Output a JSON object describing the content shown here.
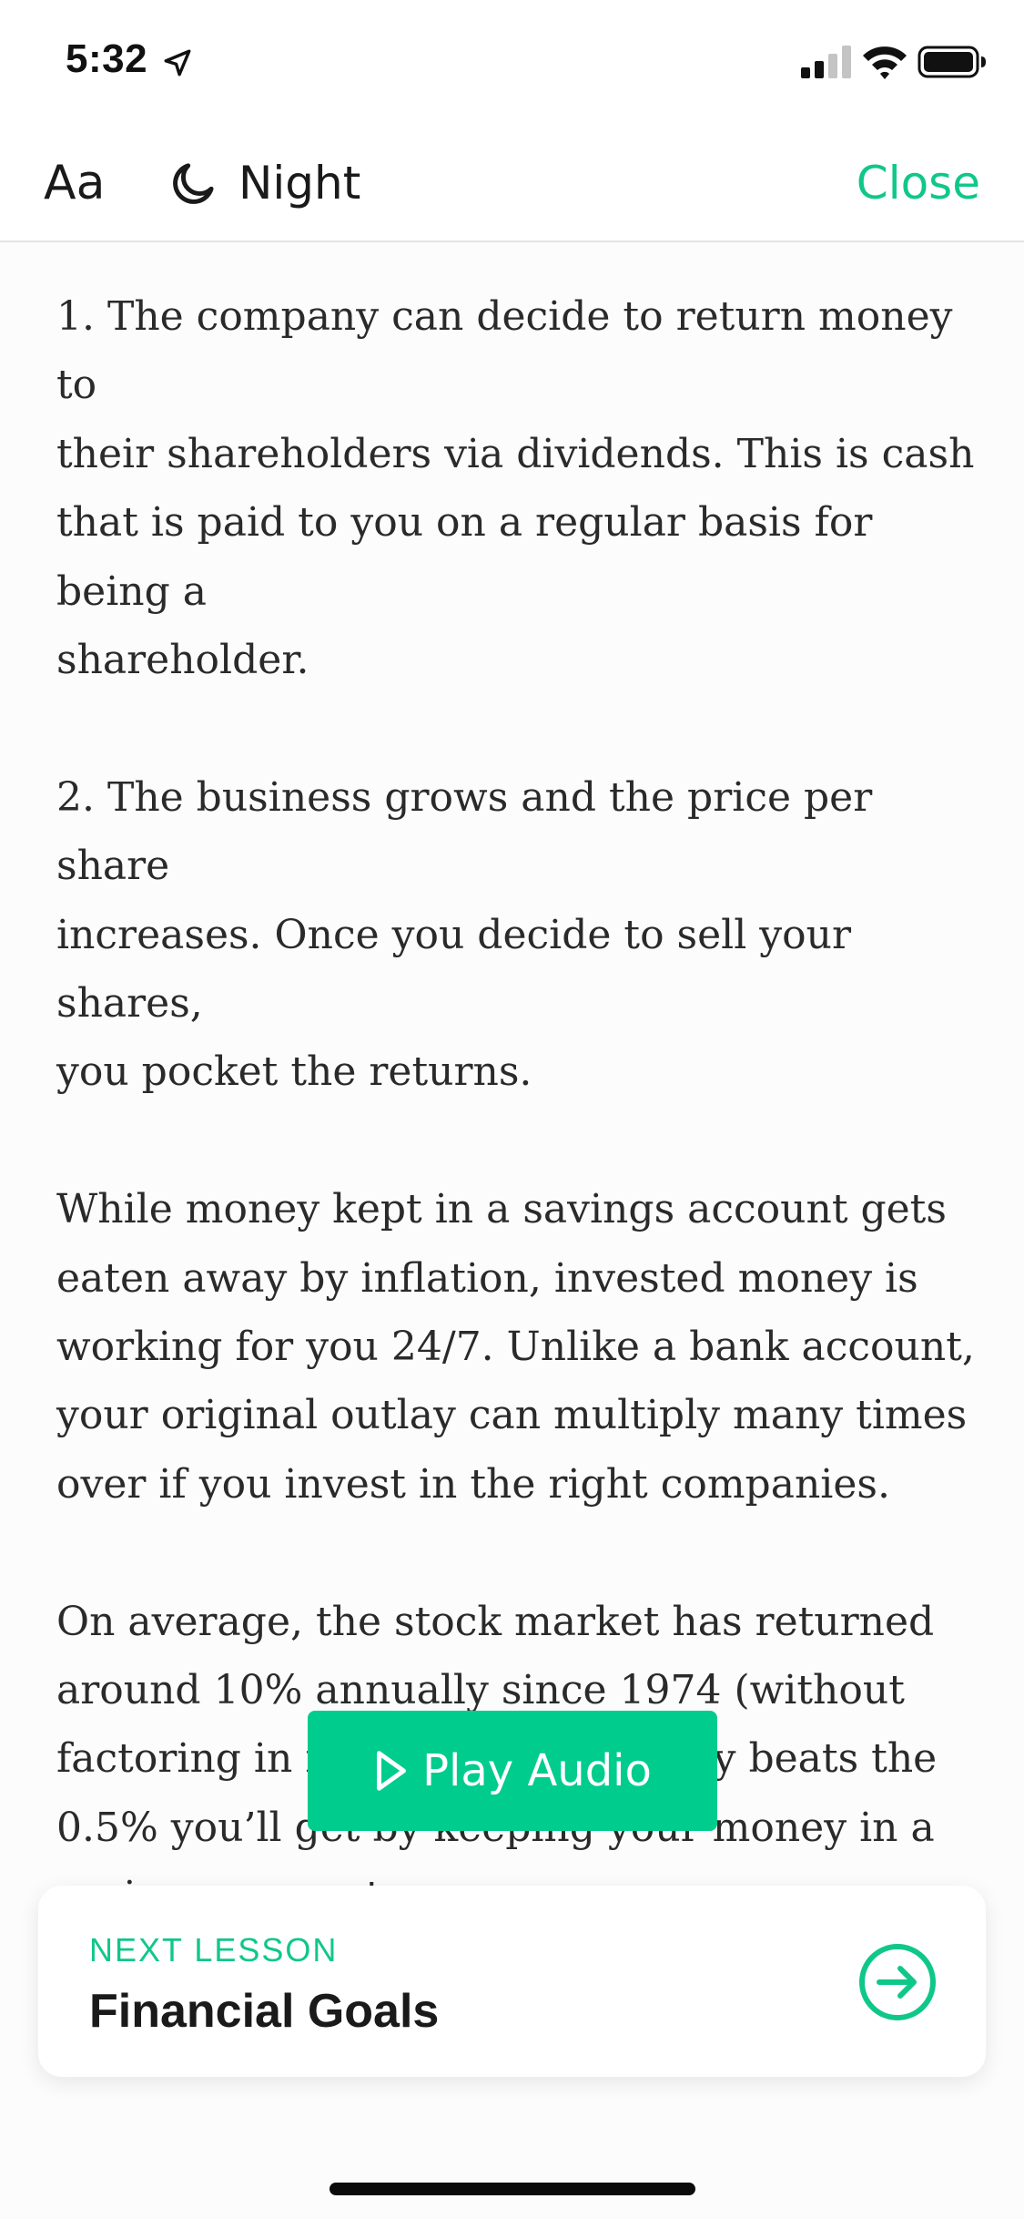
{
  "status_bar": {
    "time": "5:32",
    "icons": [
      "location-arrow-icon",
      "cellular-signal-icon",
      "wifi-icon",
      "battery-icon"
    ]
  },
  "toolbar": {
    "font_size_label": "Aa",
    "night_label": "Night",
    "night_icon": "moon-icon",
    "close_label": "Close"
  },
  "article": {
    "paragraphs": [
      "1. The company can decide to return money to\ntheir shareholders via dividends. This is cash\nthat is paid to you on a regular basis for being a\nshareholder.",
      "2. The business grows and the price per share\nincreases. Once you decide to sell your shares,\nyou pocket the returns.",
      "While money kept in a savings account gets\neaten away by inflation, invested money is\nworking for you 24/7. Unlike a bank account,\nyour original outlay can multiply many times\nover if you invest in the right companies.",
      "On average, the stock market has returned\naround 10% annually since 1974 (without\nfactoring in inflation). That easily beats the\n0.5% you’ll get by keeping your money in a\nsavings account."
    ]
  },
  "audio": {
    "play_label": "Play Audio",
    "icon": "play-icon"
  },
  "next_lesson": {
    "eyebrow": "NEXT LESSON",
    "title": "Financial Goals",
    "icon": "arrow-right-circle-icon"
  },
  "colors": {
    "accent": "#10c78a",
    "button_bg": "#00cc8e",
    "text": "#2a2a2a",
    "background": "#fcfcfc"
  }
}
